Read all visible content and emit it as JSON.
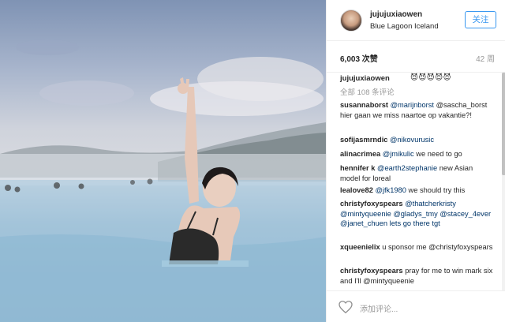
{
  "post": {
    "image_alt": "Woman raising peace sign in misty blue lagoon"
  },
  "header": {
    "username": "jujujuxiaowen",
    "location": "Blue Lagoon Iceland",
    "follow_label": "关注"
  },
  "stats": {
    "likes": "6,003 次赞",
    "time_ago": "42 周"
  },
  "caption": {
    "username": "jujujuxiaowen",
    "emoji": "😈😈😈😈😈"
  },
  "all_comments": "全部 108 条评论",
  "comments": [
    {
      "user": "susannaborst",
      "mention": "@marijnborst",
      "text": "@sascha_borst hier gaan we miss naartoe op vakantie?!"
    },
    {
      "user": "sofijasmrndic",
      "mention": "@nikovurusic",
      "text": ""
    },
    {
      "user": "alinacrimea",
      "mention": "@jmikulic",
      "text": "we need to go"
    },
    {
      "user": "hennifer k",
      "mention": "@earth2stephanie",
      "text": "new Asian model for loreal"
    },
    {
      "user": "lealove82",
      "mention": "@jfk1980",
      "text": "we should try this"
    },
    {
      "user": "christyfoxyspears",
      "mention": "@thatcherkristy",
      "text": "@mintyqueenie @gladys_tmy @stacey_4ever @janet_chuen lets go there tgt"
    },
    {
      "user": "xqueenielix",
      "mention": "",
      "text": "u sponsor me @christyfoxyspears"
    },
    {
      "user": "christyfoxyspears",
      "mention": "",
      "text": "pray for me to win mark six and I'll @mintyqueenie"
    }
  ],
  "footer": {
    "add_comment_placeholder": "添加评论..."
  },
  "colors": {
    "accent": "#3897f0",
    "mention": "#003569",
    "muted": "#999999"
  }
}
